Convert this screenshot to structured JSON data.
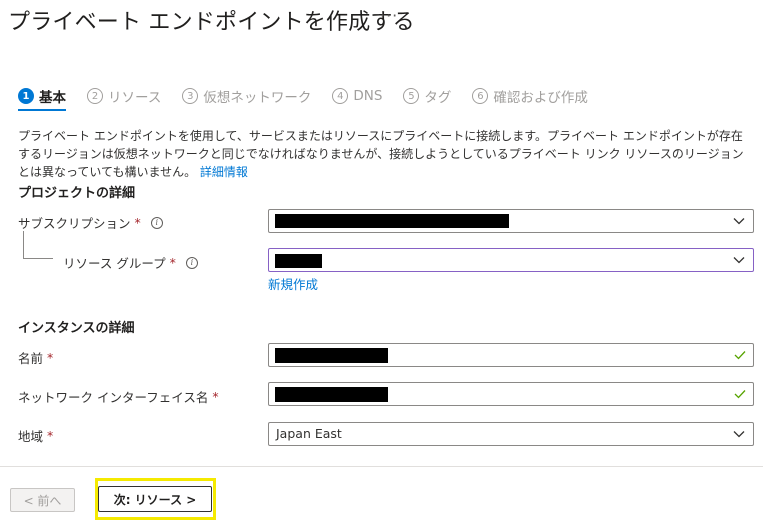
{
  "header": {
    "title": "プライベート エンドポイントを作成する",
    "more": "···"
  },
  "tabs": [
    {
      "num": "1",
      "label": "基本"
    },
    {
      "num": "2",
      "label": "リソース"
    },
    {
      "num": "3",
      "label": "仮想ネットワーク"
    },
    {
      "num": "4",
      "label": "DNS"
    },
    {
      "num": "5",
      "label": "タグ"
    },
    {
      "num": "6",
      "label": "確認および作成"
    }
  ],
  "description": {
    "text": "プライベート エンドポイントを使用して、サービスまたはリソースにプライベートに接続します。プライベート エンドポイントが存在するリージョンは仮想ネットワークと同じでなければなりませんが、接続しようとしているプライベート リンク リソースのリージョンとは異なっていても構いません。",
    "link": "詳細情報"
  },
  "project": {
    "heading": "プロジェクトの詳細",
    "subscription_label": "サブスクリプション",
    "resource_group_label": "リソース グループ",
    "create_new": "新規作成"
  },
  "instance": {
    "heading": "インスタンスの詳細",
    "name_label": "名前",
    "nic_label": "ネットワーク インターフェイス名",
    "region_label": "地域",
    "region_value": "Japan East"
  },
  "required_mark": "*",
  "info_mark": "i",
  "footer": {
    "prev_label": "< 前へ",
    "next_label": "次: リソース >"
  },
  "colors": {
    "accent": "#0078d4",
    "required": "#a4262c",
    "valid_check": "#57a300",
    "highlight": "#f5ea00",
    "focus_border": "#8661c5"
  },
  "icons": {
    "dropdown": "chevron-down-icon",
    "valid": "checkmark-icon",
    "info": "info-icon",
    "more": "ellipsis-icon"
  }
}
